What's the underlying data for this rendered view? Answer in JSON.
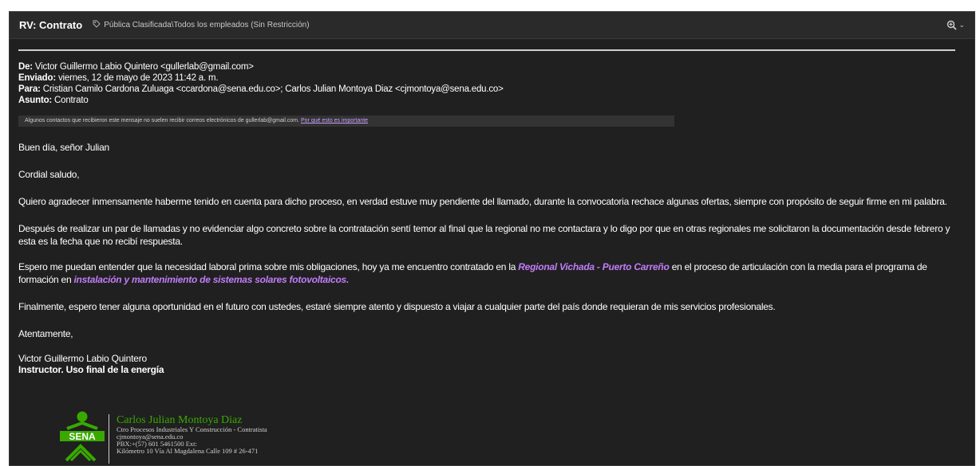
{
  "header": {
    "subject": "RV: Contrato",
    "sensitivity_icon": "tag-icon",
    "sensitivity": "Pública Clasificada\\Todos los empleados (Sin Restricción)",
    "zoom_icon": "zoom-in-icon",
    "chevron": "⌄"
  },
  "email": {
    "from_label": "De:",
    "from_value": " Victor Guillermo Labio Quintero <gullerlab@gmail.com>",
    "sent_label": "Enviado:",
    "sent_value": " viernes, 12 de mayo de 2023 11:42 a. m.",
    "to_label": "Para:",
    "to_value": " Cristian Camilo Cardona Zuluaga <ccardona@sena.edu.co>; Carlos Julian Montoya Diaz <cjmontoya@sena.edu.co>",
    "subject_label": "Asunto:",
    "subject_value": " Contrato"
  },
  "banner": {
    "text": "Algunos contactos que recibieron este mensaje no suelen recibir correos electrónicos de gullerlab@gmail.com. ",
    "link": "Por qué esto es importante"
  },
  "body": {
    "greeting": "Buen día, señor Julian",
    "salute": "Cordial saludo,",
    "p1": "Quiero agradecer inmensamente haberme tenido en cuenta para dicho proceso, en verdad estuve muy pendiente del llamado,  durante la convocatoria  rechace algunas ofertas, siempre con propósito de seguir firme en mi palabra.",
    "p2": "Después de realizar un par de llamadas y no evidenciar algo concreto sobre la contratación  sentí temor al final que la regional no me contactara y lo digo por que en otras regionales me solicitaron la documentación desde febrero y esta es la fecha que no recibí respuesta.",
    "p3a": "Espero me puedan entender que la necesidad laboral prima sobre mis obligaciones, hoy ya me encuentro contratado en la ",
    "p3b": "Regional Vichada - Puerto Carreño",
    "p3c": " en el proceso de articulación con la media para el programa de formación en ",
    "p3d": "instalación y mantenimiento de sistemas solares fotovoltaicos.",
    "p4": "Finalmente, espero tener alguna oportunidad en el futuro con ustedes, estaré siempre atento y dispuesto a viajar a cualquier parte del país donde requieran de mis servicios profesionales.",
    "closing": "Atentamente,",
    "sig_name": "Victor Guillermo Labio Quintero",
    "sig_title": "Instructor. Uso final de la energía"
  },
  "signature": {
    "logo": "SENA",
    "name": "Carlos Julian Montoya Diaz",
    "line1": "Ctro Procesos Industriales Y Construcción - Contratista",
    "email": "cjmontoya@sena.edu.co",
    "phone": "PBX:+(57) 601 5461500 Ext:",
    "address": "Kilómetro 10 Vía Al Magdalena Calle 109 # 26-471"
  },
  "colors": {
    "background": "#202020",
    "accent_purple": "#c27cf8",
    "sena_green": "#39a900"
  }
}
